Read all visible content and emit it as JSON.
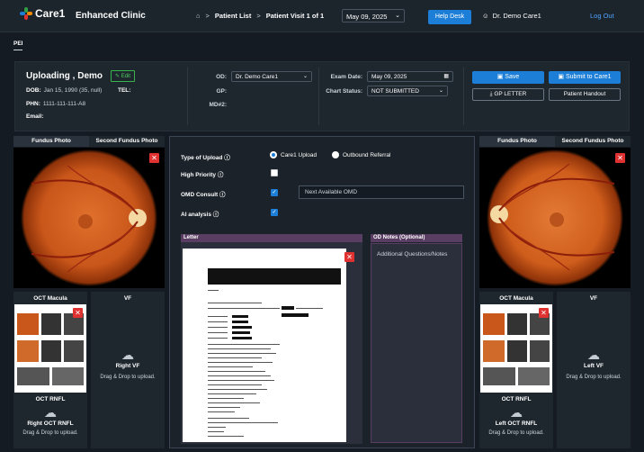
{
  "header": {
    "logo_text": "Care1",
    "clinic_name": "Enhanced Clinic",
    "breadcrumb": [
      "Patient List",
      "Patient Visit 1 of 1"
    ],
    "visit_date": "May 09, 2025",
    "help_label": "Help Desk",
    "user_name": "Dr. Demo Care1",
    "logout_label": "Log Out"
  },
  "tabs": [
    "PEI"
  ],
  "patient": {
    "name": "Uploading , Demo",
    "edit_label": "Edit",
    "dob_label": "DOB:",
    "dob": "Jan 15, 1990 (35, null)",
    "tel_label": "TEL:",
    "phn_label": "PHN:",
    "phn": "1111-111-111-A8",
    "email_label": "Email:",
    "od_label": "OD:",
    "od_value": "Dr. Demo Care1",
    "gp_label": "GP:",
    "md2_label": "MD#2:",
    "exam_date_label": "Exam Date:",
    "exam_date": "May 09, 2025",
    "chart_status_label": "Chart Status:",
    "chart_status": "NOT SUBMITTED",
    "save_label": "Save",
    "submit_label": "Submit to Care1",
    "gp_letter_label": "GP LETTER",
    "handout_label": "Patient Handout"
  },
  "left": {
    "tab_fundus": "Fundus Photo",
    "tab_second": "Second Fundus Photo",
    "oct_macula": "OCT Macula",
    "vf": "VF",
    "vf_upload_title": "Right VF",
    "upload_hint": "Drag & Drop to upload.",
    "oct_rnfl": "OCT RNFL",
    "rnfl_upload_title": "Right OCT RNFL"
  },
  "right": {
    "tab_fundus": "Fundus Photo",
    "tab_second": "Second Fundus Photo",
    "oct_macula": "OCT Macula",
    "vf": "VF",
    "vf_upload_title": "Left VF",
    "upload_hint": "Drag & Drop to upload.",
    "oct_rnfl": "OCT RNFL",
    "rnfl_upload_title": "Left OCT RNFL"
  },
  "center": {
    "type_label": "Type of Upload",
    "opt_care1": "Care1 Upload",
    "opt_referral": "Outbound Referral",
    "priority_label": "High Priority",
    "omd_label": "OMD Consult",
    "omd_value": "Next Available OMD",
    "ai_label": "AI analysis",
    "letter_label": "Letter",
    "notes_label": "OD Notes (Optional)",
    "notes_placeholder": "Additional Questions/Notes"
  },
  "colors": {
    "accent": "#1c7ed6",
    "danger": "#e03131",
    "panel_header": "#5a3d63",
    "edit_green": "#4fcf5e"
  }
}
